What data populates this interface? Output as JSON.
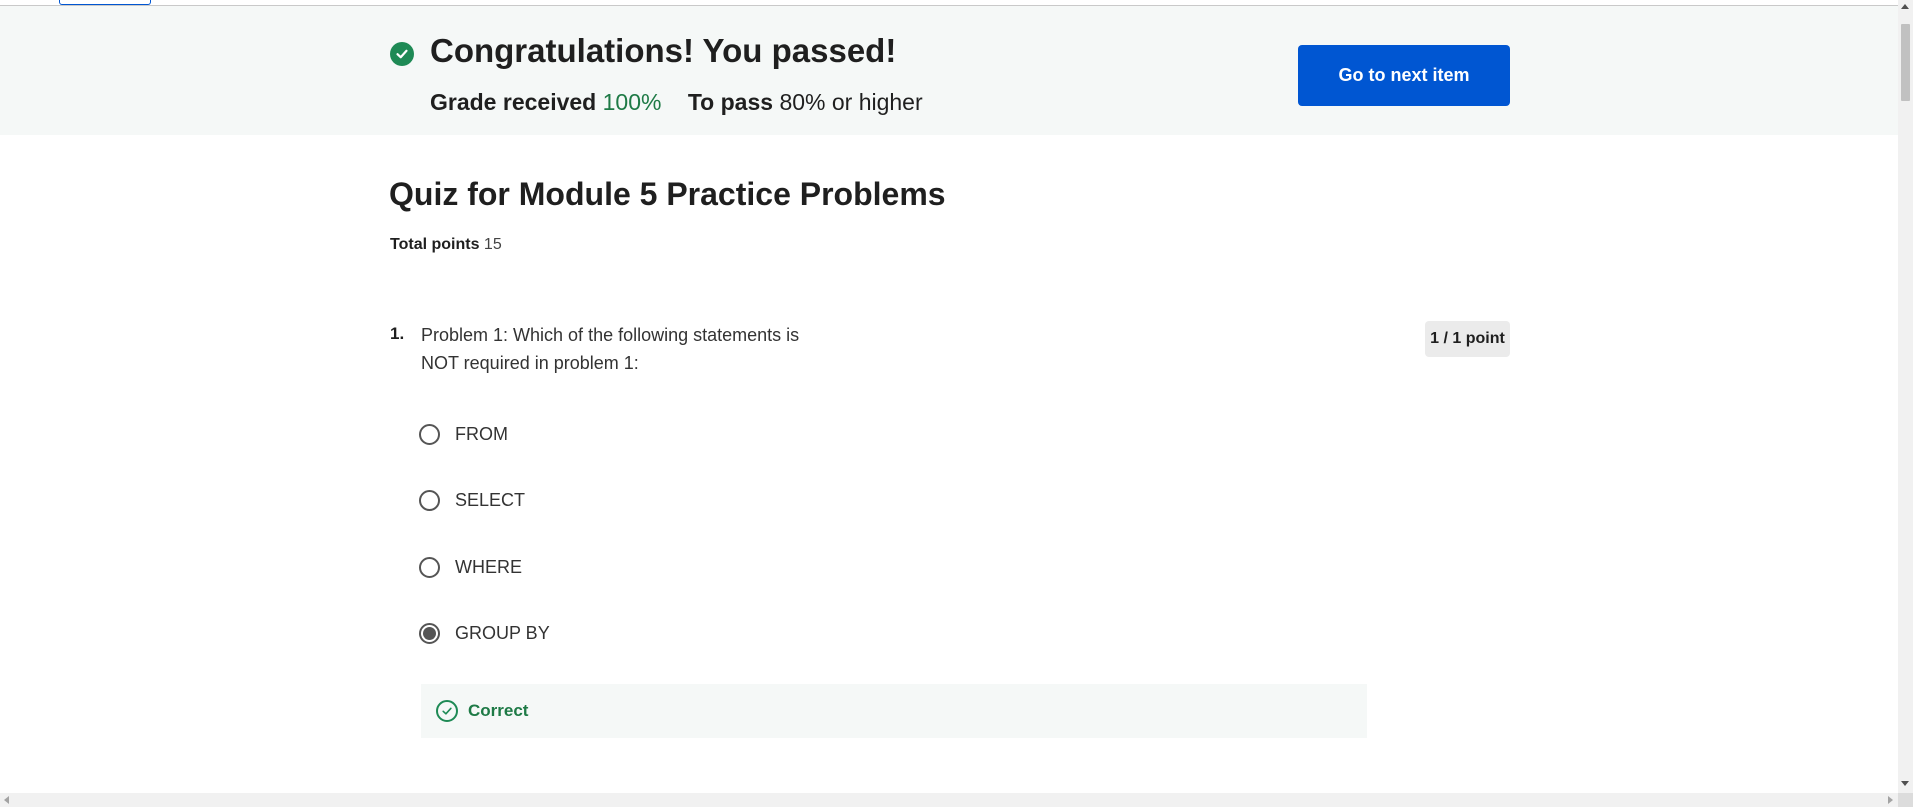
{
  "banner": {
    "title": "Congratulations! You passed!",
    "grade_label": "Grade received",
    "grade_value": "100%",
    "pass_label": "To pass",
    "pass_value": "80% or higher",
    "next_button": "Go to next item"
  },
  "quiz": {
    "title": "Quiz for Module 5 Practice Problems",
    "total_points_label": "Total points",
    "total_points_value": "15"
  },
  "question": {
    "number": "1.",
    "text": "Problem 1: Which of the following statements is NOT required in problem 1:",
    "points": "1 / 1 point",
    "options": [
      {
        "label": "FROM",
        "selected": false
      },
      {
        "label": "SELECT",
        "selected": false
      },
      {
        "label": "WHERE",
        "selected": false
      },
      {
        "label": "GROUP BY",
        "selected": true
      }
    ],
    "feedback": "Correct"
  },
  "colors": {
    "accent": "#0056d2",
    "success": "#1e8a55",
    "banner_bg": "#f5f8f7"
  }
}
